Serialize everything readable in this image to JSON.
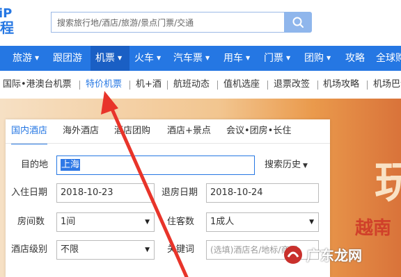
{
  "logo": {
    "line1": "iP",
    "line2": "程"
  },
  "search": {
    "placeholder": "搜索旅行地/酒店/旅游/景点门票/交通"
  },
  "nav": [
    {
      "label": "旅游"
    },
    {
      "label": "跟团游"
    },
    {
      "label": "机票"
    },
    {
      "label": "火车"
    },
    {
      "label": "汽车票"
    },
    {
      "label": "用车"
    },
    {
      "label": "门票"
    },
    {
      "label": "团购"
    },
    {
      "label": "攻略"
    },
    {
      "label": "全球购"
    }
  ],
  "subnav": [
    "国际•港澳台机票",
    "特价机票",
    "机+酒",
    "航班动态",
    "值机选座",
    "退票改签",
    "机场攻略",
    "机场巴士"
  ],
  "banner": {
    "char1": "玩",
    "char2": "越南"
  },
  "hotel": {
    "tabs": [
      "国内酒店",
      "海外酒店",
      "酒店团购",
      "酒店+景点",
      "会议•团房•长住"
    ],
    "destination_label": "目的地",
    "destination_value": "上海",
    "history_label": "搜索历史",
    "checkin_label": "入住日期",
    "checkin_value": "2018-10-23",
    "checkout_label": "退房日期",
    "checkout_value": "2018-10-24",
    "rooms_label": "房间数",
    "rooms_value": "1间",
    "guests_label": "住客数",
    "guests_value": "1成人",
    "star_label": "酒店级别",
    "star_value": "不限",
    "keyword_label": "关键词",
    "keyword_placeholder": "(选填)酒店名/地标/商圈"
  },
  "watermark": {
    "text": "广东龙网"
  },
  "colors": {
    "brand": "#2577e3",
    "annotation_arrow": "#e8342a"
  }
}
